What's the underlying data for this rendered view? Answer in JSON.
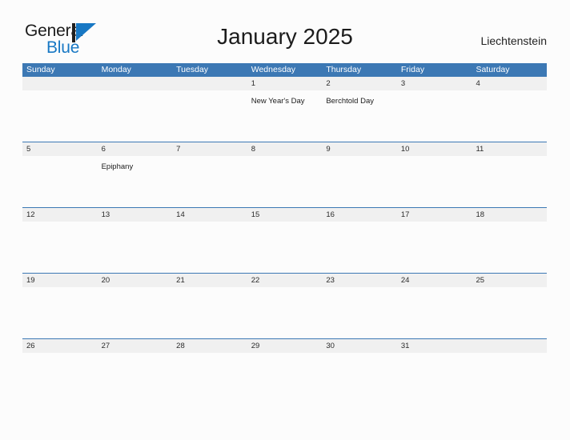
{
  "logo": {
    "word_one": "General",
    "word_two": "Blue",
    "mark_icon": "blue-triangle-flag-icon",
    "mark_color": "#1878c4",
    "word_two_color": "#1878c4"
  },
  "header": {
    "title": "January 2025",
    "country": "Liechtenstein"
  },
  "colors": {
    "header_blue": "#3c78b4",
    "band_gray": "#f0f0f0",
    "page_background": "#fcfcfc",
    "accent_blue": "#1878c4"
  },
  "calendar": {
    "weekdays": [
      "Sunday",
      "Monday",
      "Tuesday",
      "Wednesday",
      "Thursday",
      "Friday",
      "Saturday"
    ],
    "weeks": [
      [
        {
          "day": "",
          "event": ""
        },
        {
          "day": "",
          "event": ""
        },
        {
          "day": "",
          "event": ""
        },
        {
          "day": "1",
          "event": "New Year's Day"
        },
        {
          "day": "2",
          "event": "Berchtold Day"
        },
        {
          "day": "3",
          "event": ""
        },
        {
          "day": "4",
          "event": ""
        }
      ],
      [
        {
          "day": "5",
          "event": ""
        },
        {
          "day": "6",
          "event": "Epiphany"
        },
        {
          "day": "7",
          "event": ""
        },
        {
          "day": "8",
          "event": ""
        },
        {
          "day": "9",
          "event": ""
        },
        {
          "day": "10",
          "event": ""
        },
        {
          "day": "11",
          "event": ""
        }
      ],
      [
        {
          "day": "12",
          "event": ""
        },
        {
          "day": "13",
          "event": ""
        },
        {
          "day": "14",
          "event": ""
        },
        {
          "day": "15",
          "event": ""
        },
        {
          "day": "16",
          "event": ""
        },
        {
          "day": "17",
          "event": ""
        },
        {
          "day": "18",
          "event": ""
        }
      ],
      [
        {
          "day": "19",
          "event": ""
        },
        {
          "day": "20",
          "event": ""
        },
        {
          "day": "21",
          "event": ""
        },
        {
          "day": "22",
          "event": ""
        },
        {
          "day": "23",
          "event": ""
        },
        {
          "day": "24",
          "event": ""
        },
        {
          "day": "25",
          "event": ""
        }
      ],
      [
        {
          "day": "26",
          "event": ""
        },
        {
          "day": "27",
          "event": ""
        },
        {
          "day": "28",
          "event": ""
        },
        {
          "day": "29",
          "event": ""
        },
        {
          "day": "30",
          "event": ""
        },
        {
          "day": "31",
          "event": ""
        },
        {
          "day": "",
          "event": ""
        }
      ]
    ]
  }
}
